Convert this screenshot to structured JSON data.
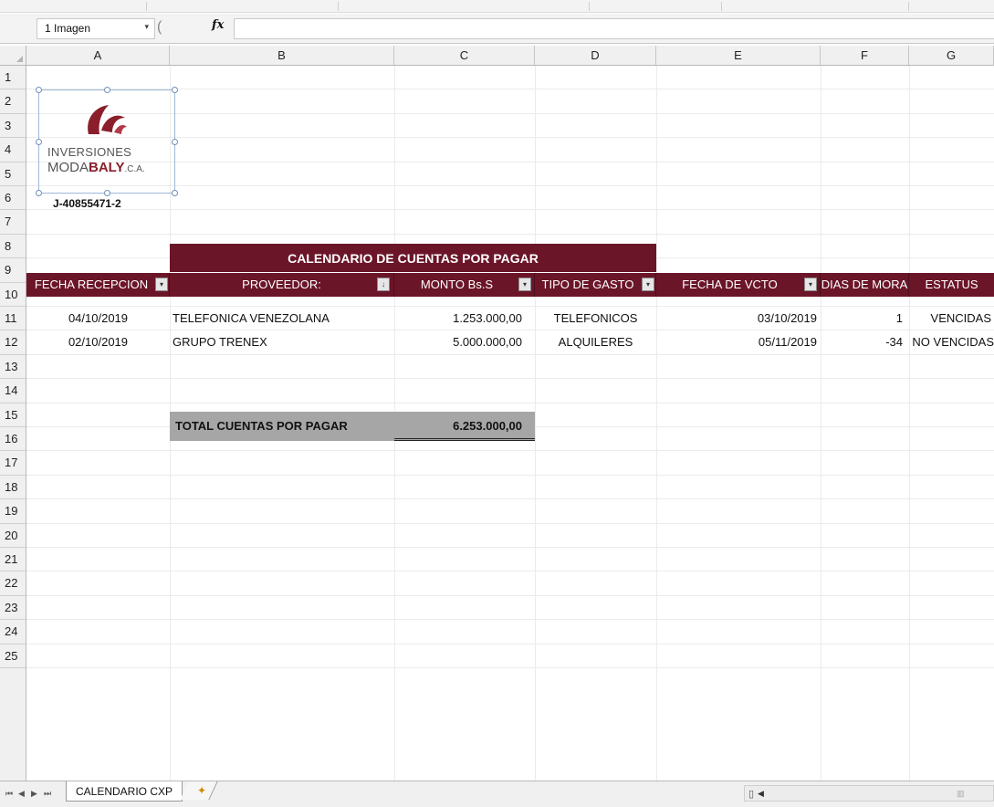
{
  "formula_bar": {
    "name_box": "1 Imagen",
    "name_box_dropdown": "▾",
    "paren": "(",
    "fx": "fx",
    "formula": ""
  },
  "columns": [
    "A",
    "B",
    "C",
    "D",
    "E",
    "F",
    "G"
  ],
  "rows": [
    "1",
    "2",
    "3",
    "4",
    "5",
    "6",
    "7",
    "8",
    "9",
    "10",
    "11",
    "12",
    "13",
    "14",
    "15",
    "16",
    "17",
    "18",
    "19",
    "20",
    "21",
    "22",
    "23",
    "24",
    "25"
  ],
  "logo": {
    "line1": "INVERSIONES",
    "line2_a": "MODA",
    "line2_b": "BALY",
    "line2_c": ".C.A.",
    "rif": "J-40855471-2"
  },
  "banner_title": "CALENDARIO DE CUENTAS POR PAGAR",
  "table": {
    "headers": [
      "FECHA RECEPCION",
      "PROVEEDOR:",
      "MONTO Bs.S",
      "TIPO DE GASTO",
      "FECHA DE VCTO",
      "DIAS DE MORA",
      "ESTATUS"
    ],
    "filter_icons": {
      "default": "▾",
      "sorted": "↓"
    },
    "rows": [
      [
        "04/10/2019",
        "TELEFONICA VENEZOLANA",
        "1.253.000,00",
        "TELEFONICOS",
        "03/10/2019",
        "1",
        "VENCIDAS"
      ],
      [
        "02/10/2019",
        "GRUPO TRENEX",
        "5.000.000,00",
        "ALQUILERES",
        "05/11/2019",
        "-34",
        "NO VENCIDAS"
      ]
    ]
  },
  "totals": {
    "label": "TOTAL CUENTAS POR PAGAR",
    "value": "6.253.000,00"
  },
  "sheet_tabs": {
    "active": "CALENDARIO CXP",
    "nav": [
      "⏮",
      "◀",
      "▶",
      "⏭"
    ]
  },
  "colors": {
    "header_bg": "#6b1528",
    "total_bg": "#a6a6a6"
  }
}
